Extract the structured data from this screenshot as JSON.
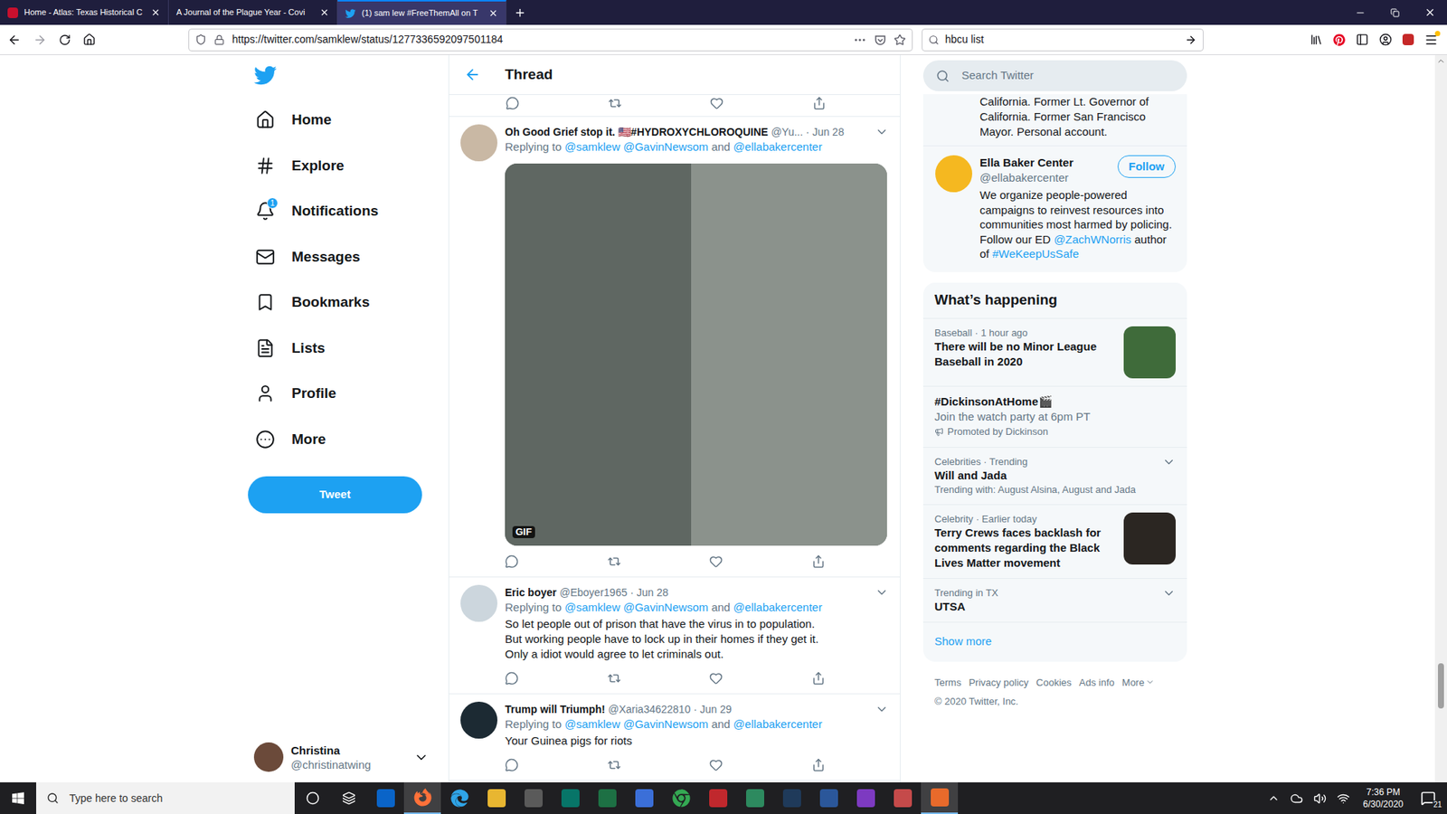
{
  "browser": {
    "tabs": [
      {
        "label": "Home - Atlas: Texas Historical C",
        "selected": false
      },
      {
        "label": "A Journal of the Plague Year - Covi",
        "selected": false
      },
      {
        "label": "(1) sam lew #FreeThemAll on T",
        "selected": true
      }
    ],
    "url": "https://twitter.com/samklew/status/1277336592097501184",
    "search": "hbcu list"
  },
  "nav": {
    "items": [
      {
        "label": "Home",
        "badge": ""
      },
      {
        "label": "Explore",
        "badge": ""
      },
      {
        "label": "Notifications",
        "badge": "1"
      },
      {
        "label": "Messages",
        "badge": ""
      },
      {
        "label": "Bookmarks",
        "badge": ""
      },
      {
        "label": "Lists",
        "badge": ""
      },
      {
        "label": "Profile",
        "badge": ""
      },
      {
        "label": "More",
        "badge": ""
      }
    ],
    "tweet_button": "Tweet",
    "account": {
      "name": "Christina",
      "handle": "@christinatwing"
    }
  },
  "thread": {
    "title": "Thread",
    "tweets": [
      {
        "kind": "gif",
        "name": "Oh Good Grief stop it. 🇺🇸#HYDROXYCHLOROQUINE",
        "handle": "@Yu...",
        "date": "· Jun 28",
        "replying": [
          {
            "text": "Replying to ",
            "link": false
          },
          {
            "text": "@samklew @GavinNewsom",
            "link": true
          },
          {
            "text": " and ",
            "link": false
          },
          {
            "text": "@ellabakercenter",
            "link": true
          }
        ],
        "media_label": "GIF",
        "lines": []
      },
      {
        "kind": "text",
        "name": "Eric boyer",
        "handle": "@Eboyer1965",
        "date": "· Jun 28",
        "replying": [
          {
            "text": "Replying to ",
            "link": false
          },
          {
            "text": "@samklew @GavinNewsom",
            "link": true
          },
          {
            "text": " and ",
            "link": false
          },
          {
            "text": "@ellabakercenter",
            "link": true
          }
        ],
        "media_label": "",
        "lines": [
          "So let people out of prison that have the virus in to population.",
          "But working people have to lock up in their homes if they get it.",
          "Only a idiot would agree to let criminals out."
        ]
      },
      {
        "kind": "text",
        "name": "Trump will Triumph!",
        "handle": "@Xaria34622810",
        "date": "· Jun 29",
        "replying": [
          {
            "text": "Replying to ",
            "link": false
          },
          {
            "text": "@samklew @GavinNewsom",
            "link": true
          },
          {
            "text": " and ",
            "link": false
          },
          {
            "text": "@ellabakercenter",
            "link": true
          }
        ],
        "media_label": "",
        "lines": [
          "Your Guinea pigs for riots"
        ]
      }
    ]
  },
  "sidebar": {
    "search_placeholder": "Search Twitter",
    "previous_bio_lines": [
      "California. Former Lt. Governor of",
      "California. Former San Francisco",
      "Mayor. Personal account."
    ],
    "follow": {
      "name": "Ella Baker Center",
      "handle": "@ellabakercenter",
      "button": "Follow",
      "bio": [
        {
          "text": "We organize people-powered campaigns to reinvest resources into communities most harmed by policing. Follow our ED ",
          "link": false
        },
        {
          "text": "@ZachWNorris",
          "link": true
        },
        {
          "text": " author of ",
          "link": false
        },
        {
          "text": "#WeKeepUsSafe",
          "link": true
        }
      ]
    },
    "trends": {
      "title": "What’s happening",
      "items": [
        {
          "kind": "image",
          "meta": "Baseball · 1 hour ago",
          "title": "There will be no Minor League Baseball in 2020",
          "description": "",
          "promoted": ""
        },
        {
          "kind": "promoted",
          "meta": "",
          "title": "#DickinsonAtHome🎬",
          "description": "Join the watch party at 6pm PT",
          "promoted": "Promoted by Dickinson"
        },
        {
          "kind": "trend",
          "meta": "Celebrities · Trending",
          "title": "Will and Jada",
          "description": "Trending with: August Alsina, August and Jada",
          "promoted": ""
        },
        {
          "kind": "image",
          "meta": "Celebrity · Earlier today",
          "title": "Terry Crews faces backlash for comments regarding the Black Lives Matter movement",
          "description": "",
          "promoted": ""
        },
        {
          "kind": "trend",
          "meta": "Trending in TX",
          "title": "UTSA",
          "description": "",
          "promoted": ""
        }
      ],
      "show_more": "Show more"
    },
    "footer": {
      "links": [
        "Terms",
        "Privacy policy",
        "Cookies",
        "Ads info"
      ],
      "more": "More",
      "copyright": "© 2020 Twitter, Inc."
    }
  },
  "taskbar": {
    "search_placeholder": "Type here to search",
    "apps": [
      {
        "active": false
      },
      {
        "active": true
      },
      {
        "active": false
      },
      {
        "active": false
      },
      {
        "active": false
      },
      {
        "active": false
      },
      {
        "active": false
      },
      {
        "active": false
      },
      {
        "active": false
      },
      {
        "active": false
      },
      {
        "active": false
      },
      {
        "active": false
      },
      {
        "active": false
      },
      {
        "active": false
      },
      {
        "active": false
      },
      {
        "active": true
      }
    ],
    "time": "7:36 PM",
    "date": "6/30/2020",
    "notifications": "21"
  }
}
